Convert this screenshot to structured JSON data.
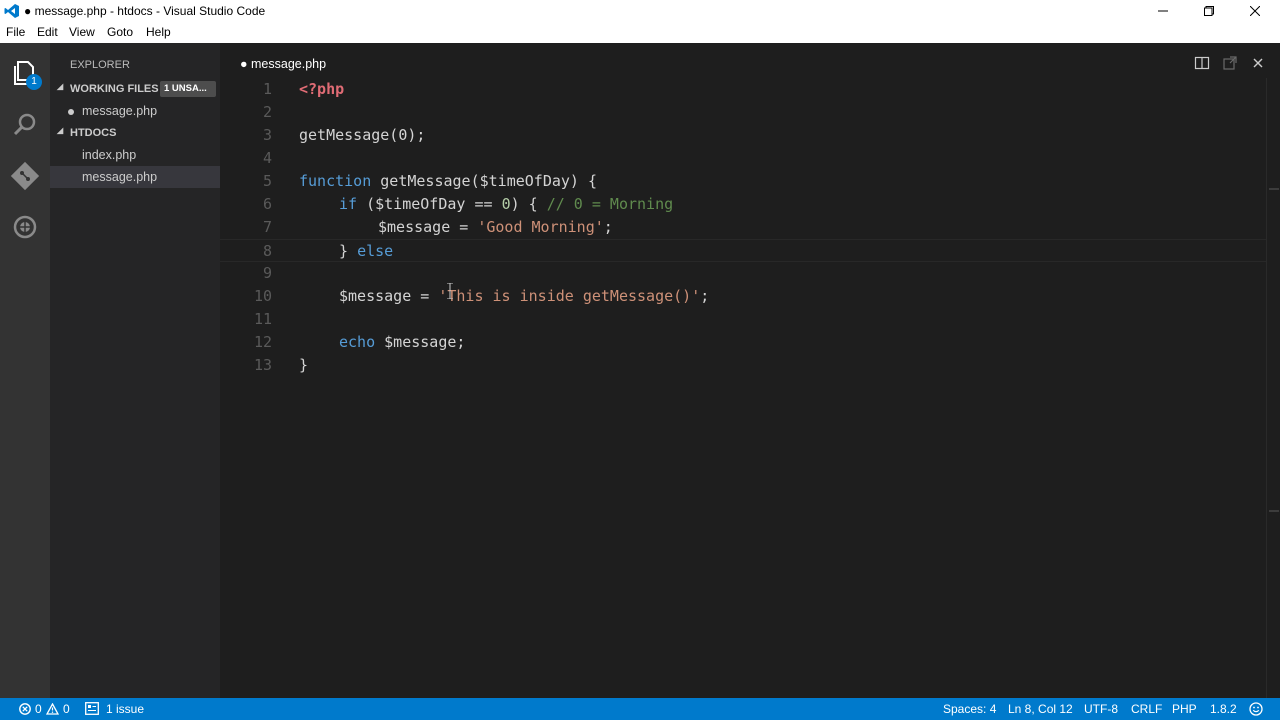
{
  "window": {
    "title": "● message.php - htdocs - Visual Studio Code"
  },
  "menu": [
    "File",
    "Edit",
    "View",
    "Goto",
    "Help"
  ],
  "activity": {
    "explorer_badge": "1"
  },
  "sidebar": {
    "title": "EXPLORER",
    "working_files": {
      "label": "WORKING FILES",
      "badge": "1 UNSA...",
      "items": [
        "message.php"
      ]
    },
    "folder": {
      "label": "HTDOCS",
      "items": [
        "index.php",
        "message.php"
      ]
    }
  },
  "editor": {
    "tab": "● message.php",
    "line_numbers": [
      "1",
      "2",
      "3",
      "4",
      "5",
      "6",
      "7",
      "8",
      "9",
      "10",
      "11",
      "12",
      "13"
    ],
    "code": {
      "l1": "<?php",
      "l3": "getMessage(0);",
      "l5_kw": "function",
      "l5_rest": " getMessage($timeOfDay) {",
      "l6_kw": "if",
      "l6_a": " ($timeOfDay == ",
      "l6_num": "0",
      "l6_b": ") { ",
      "l6_cmt": "// 0 = Morning",
      "l7_a": "$message = ",
      "l7_str": "'Good Morning'",
      "l7_b": ";",
      "l8_a": "} ",
      "l8_kw": "else",
      "l10_a": "$message = ",
      "l10_str": "'This is inside getMessage()'",
      "l10_b": ";",
      "l12_kw": "echo",
      "l12_rest": " $message;",
      "l13": "}"
    }
  },
  "status": {
    "errors": "0",
    "warnings": "0",
    "issues": "1 issue",
    "spaces": "Spaces: 4",
    "position": "Ln 8, Col 12",
    "encoding": "UTF-8",
    "eol": "CRLF",
    "language": "PHP",
    "version": "1.8.2"
  },
  "colors": {
    "accent": "#007acc",
    "keyword": "#569cd6",
    "string": "#ce9178",
    "comment": "#608b4e",
    "php_tag": "#e06c75"
  }
}
